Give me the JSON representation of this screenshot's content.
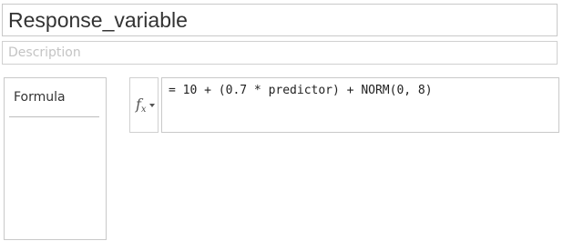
{
  "variable": {
    "name": "Response_variable",
    "description_placeholder": "Description"
  },
  "sidebar": {
    "items": [
      {
        "label": "Formula"
      }
    ]
  },
  "formula": {
    "function_button_icon": "function-fx-icon",
    "expression": "= 10 + (0.7 * predictor) + NORM(0, 8)"
  }
}
